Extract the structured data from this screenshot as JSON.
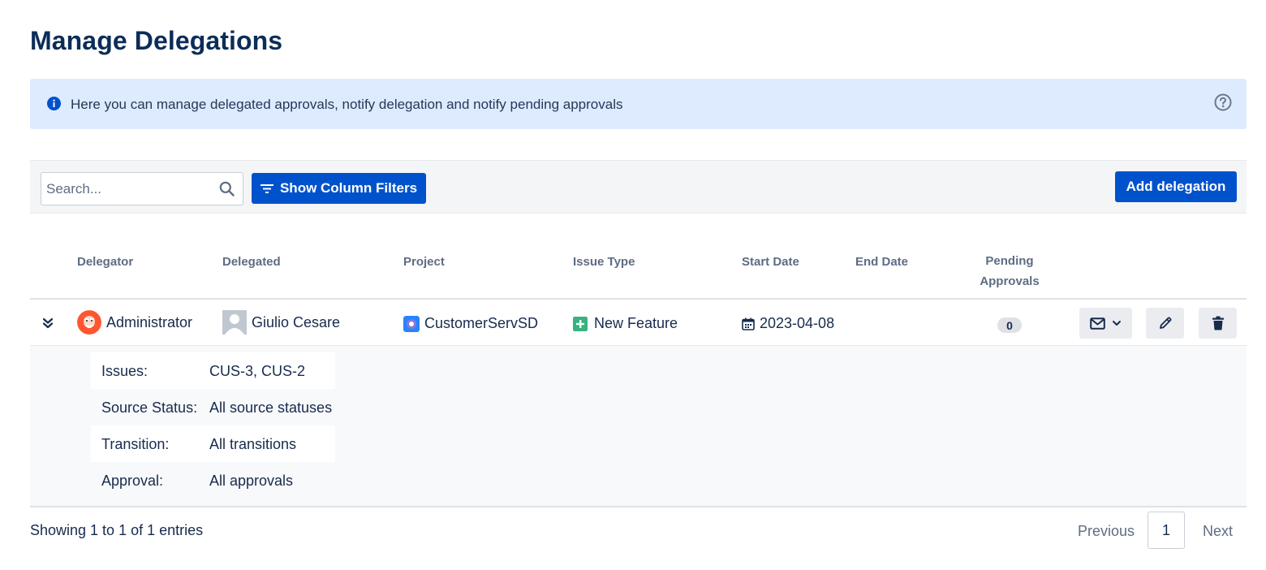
{
  "page": {
    "title": "Manage Delegations"
  },
  "banner": {
    "icon": "info-icon",
    "text": "Here you can manage delegated approvals, notify delegation and notify pending approvals",
    "help_icon": "help-icon"
  },
  "toolbar": {
    "search_placeholder": "Search...",
    "filters_label": "Show Column Filters",
    "add_label": "Add delegation"
  },
  "table": {
    "headers": {
      "delegator": "Delegator",
      "delegated": "Delegated",
      "project": "Project",
      "issue_type": "Issue Type",
      "start_date": "Start Date",
      "end_date": "End Date",
      "pending_line1": "Pending",
      "pending_line2": "Approvals"
    },
    "rows": [
      {
        "delegator": "Administrator",
        "delegated": "Giulio Cesare",
        "project": "CustomerServSD",
        "issue_type": "New Feature",
        "start_date": "2023-04-08",
        "end_date": "",
        "pending": "0",
        "details": [
          {
            "key": "Issues:",
            "value": "CUS-3, CUS-2"
          },
          {
            "key": "Source Status:",
            "value": "All source statuses"
          },
          {
            "key": "Transition:",
            "value": "All transitions"
          },
          {
            "key": "Approval:",
            "value": "All approvals"
          }
        ]
      }
    ]
  },
  "footer": {
    "info": "Showing 1 to 1 of 1 entries",
    "previous": "Previous",
    "page": "1",
    "next": "Next"
  },
  "colors": {
    "primary": "#0052cc",
    "banner_bg": "#deebff",
    "title": "#0c2d57",
    "new_feature_green": "#36b37e",
    "avatar_orange": "#ff5630"
  }
}
